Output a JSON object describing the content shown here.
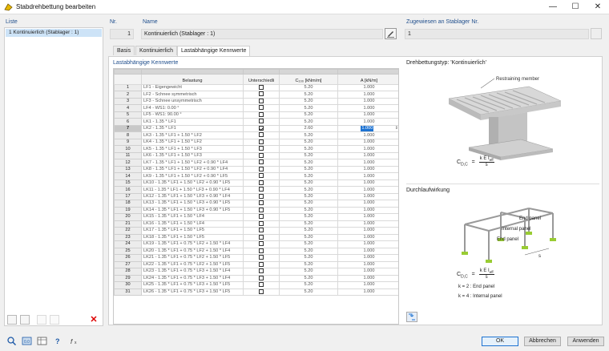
{
  "window": {
    "title": "Stabdrehbettung bearbeiten",
    "min": "—",
    "max": "☐",
    "close": "✕"
  },
  "list": {
    "header": "Liste",
    "item": "1  Kontinuierlich (Stablager : 1)"
  },
  "nr": {
    "label": "Nr.",
    "value": "1"
  },
  "name": {
    "label": "Name",
    "value": "Kontinuierlich (Stablager : 1)"
  },
  "assigned": {
    "label": "Zugewiesen an Stablager Nr.",
    "value": "1"
  },
  "tabs": [
    "Basis",
    "Kontinuierlich",
    "Lastabhängige Kennwerte"
  ],
  "section_title": "Lastabhängige Kennwerte",
  "table": {
    "headers": {
      "belastung": "Belastung",
      "unterschiedlich": "Unterschiedli",
      "c100": "C₁₀₀ [kNm/m]",
      "a": "A [kN/m]"
    },
    "rows": [
      {
        "no": "1",
        "bel": "LF1 - Eigengewicht",
        "u": false,
        "c": "5.20",
        "a": "1.000"
      },
      {
        "no": "2",
        "bel": "LF2 - Schnee symmetrisch",
        "u": false,
        "c": "5.20",
        "a": "1.000"
      },
      {
        "no": "3",
        "bel": "LF3 - Schnee unsymmetrisch",
        "u": false,
        "c": "5.20",
        "a": "1.000"
      },
      {
        "no": "4",
        "bel": "LF4 - WS1: 0.00 °",
        "u": false,
        "c": "5.20",
        "a": "1.000"
      },
      {
        "no": "5",
        "bel": "LF5 - WS1: 90.00 °",
        "u": false,
        "c": "5.20",
        "a": "1.000"
      },
      {
        "no": "6",
        "bel": "LK1 - 1.35 * LF1",
        "u": false,
        "c": "5.20",
        "a": "1.000"
      },
      {
        "no": "7",
        "bel": "LK2 - 1.35 * LF1",
        "u": true,
        "c": "2.60",
        "a": "1.000",
        "sel": true
      },
      {
        "no": "8",
        "bel": "LK3 - 1.35 * LF1 + 1.50 * LF2",
        "u": false,
        "c": "5.20",
        "a": "1.000"
      },
      {
        "no": "9",
        "bel": "LK4 - 1.35 * LF1 + 1.50 * LF2",
        "u": false,
        "c": "5.20",
        "a": "1.000"
      },
      {
        "no": "10",
        "bel": "LK5 - 1.35 * LF1 + 1.50 * LF3",
        "u": false,
        "c": "5.20",
        "a": "1.000"
      },
      {
        "no": "11",
        "bel": "LK6 - 1.35 * LF1 + 1.50 * LF3",
        "u": false,
        "c": "5.20",
        "a": "1.000"
      },
      {
        "no": "12",
        "bel": "LK7 - 1.35 * LF1 + 1.50 * LF2 + 0.90 * LF4",
        "u": false,
        "c": "5.20",
        "a": "1.000"
      },
      {
        "no": "13",
        "bel": "LK8 - 1.35 * LF1 + 1.50 * LF2 + 0.90 * LF4",
        "u": false,
        "c": "5.20",
        "a": "1.000"
      },
      {
        "no": "14",
        "bel": "LK9 - 1.35 * LF1 + 1.50 * LF2 + 0.90 * LF5",
        "u": false,
        "c": "5.20",
        "a": "1.000"
      },
      {
        "no": "15",
        "bel": "LK10 - 1.35 * LF1 + 1.50 * LF2 + 0.90 * LF5",
        "u": false,
        "c": "5.20",
        "a": "1.000"
      },
      {
        "no": "16",
        "bel": "LK11 - 1.35 * LF1 + 1.50 * LF3 + 0.90 * LF4",
        "u": false,
        "c": "5.20",
        "a": "1.000"
      },
      {
        "no": "17",
        "bel": "LK12 - 1.35 * LF1 + 1.50 * LF3 + 0.90 * LF4",
        "u": false,
        "c": "5.20",
        "a": "1.000"
      },
      {
        "no": "18",
        "bel": "LK13 - 1.35 * LF1 + 1.50 * LF3 + 0.90 * LF5",
        "u": false,
        "c": "5.20",
        "a": "1.000"
      },
      {
        "no": "19",
        "bel": "LK14 - 1.35 * LF1 + 1.50 * LF3 + 0.90 * LF5",
        "u": false,
        "c": "5.20",
        "a": "1.000"
      },
      {
        "no": "20",
        "bel": "LK15 - 1.35 * LF1 + 1.50 * LF4",
        "u": false,
        "c": "5.20",
        "a": "1.000"
      },
      {
        "no": "21",
        "bel": "LK16 - 1.35 * LF1 + 1.50 * LF4",
        "u": false,
        "c": "5.20",
        "a": "1.000"
      },
      {
        "no": "22",
        "bel": "LK17 - 1.35 * LF1 + 1.50 * LF5",
        "u": false,
        "c": "5.20",
        "a": "1.000"
      },
      {
        "no": "23",
        "bel": "LK18 - 1.35 * LF1 + 1.50 * LF5",
        "u": false,
        "c": "5.20",
        "a": "1.000"
      },
      {
        "no": "24",
        "bel": "LK19 - 1.35 * LF1 + 0.75 * LF2 + 1.50 * LF4",
        "u": false,
        "c": "5.20",
        "a": "1.000"
      },
      {
        "no": "25",
        "bel": "LK20 - 1.35 * LF1 + 0.75 * LF2 + 1.50 * LF4",
        "u": false,
        "c": "5.20",
        "a": "1.000"
      },
      {
        "no": "26",
        "bel": "LK21 - 1.35 * LF1 + 0.75 * LF2 + 1.50 * LF5",
        "u": false,
        "c": "5.20",
        "a": "1.000"
      },
      {
        "no": "27",
        "bel": "LK22 - 1.35 * LF1 + 0.75 * LF2 + 1.50 * LF5",
        "u": false,
        "c": "5.20",
        "a": "1.000"
      },
      {
        "no": "28",
        "bel": "LK23 - 1.35 * LF1 + 0.75 * LF3 + 1.50 * LF4",
        "u": false,
        "c": "5.20",
        "a": "1.000"
      },
      {
        "no": "29",
        "bel": "LK24 - 1.35 * LF1 + 0.75 * LF3 + 1.50 * LF4",
        "u": false,
        "c": "5.20",
        "a": "1.000"
      },
      {
        "no": "30",
        "bel": "LK25 - 1.35 * LF1 + 0.75 * LF3 + 1.50 * LF5",
        "u": false,
        "c": "5.20",
        "a": "1.000"
      },
      {
        "no": "31",
        "bel": "LK26 - 1.35 * LF1 + 0.75 * LF3 + 1.50 * LF5",
        "u": false,
        "c": "5.20",
        "a": "1.000"
      }
    ]
  },
  "right": {
    "type_title": "Drehbettungstyp: 'Kontinuierlich'",
    "restraining": "Restraining member",
    "formula_lhs": "C",
    "formula_sub": "D,C",
    "formula_eq": "=",
    "formula_num": "k E I",
    "formula_num_sub": "eff",
    "formula_den": "s",
    "durch_title": "Durchlaufwirkung",
    "end_panel": "End panel",
    "internal_panel": "Internal panel",
    "end_panel_2": "End panel",
    "s_label": "s",
    "k2": "k  =  2 : End  panel",
    "k4": "k  =  4 : Internal  panel"
  },
  "buttons": {
    "ok": "OK",
    "cancel": "Abbrechen",
    "apply": "Anwenden"
  },
  "colors": {
    "accent": "#1e73d2",
    "selection": "#cde3f7",
    "label_blue": "#1f4e8c"
  }
}
